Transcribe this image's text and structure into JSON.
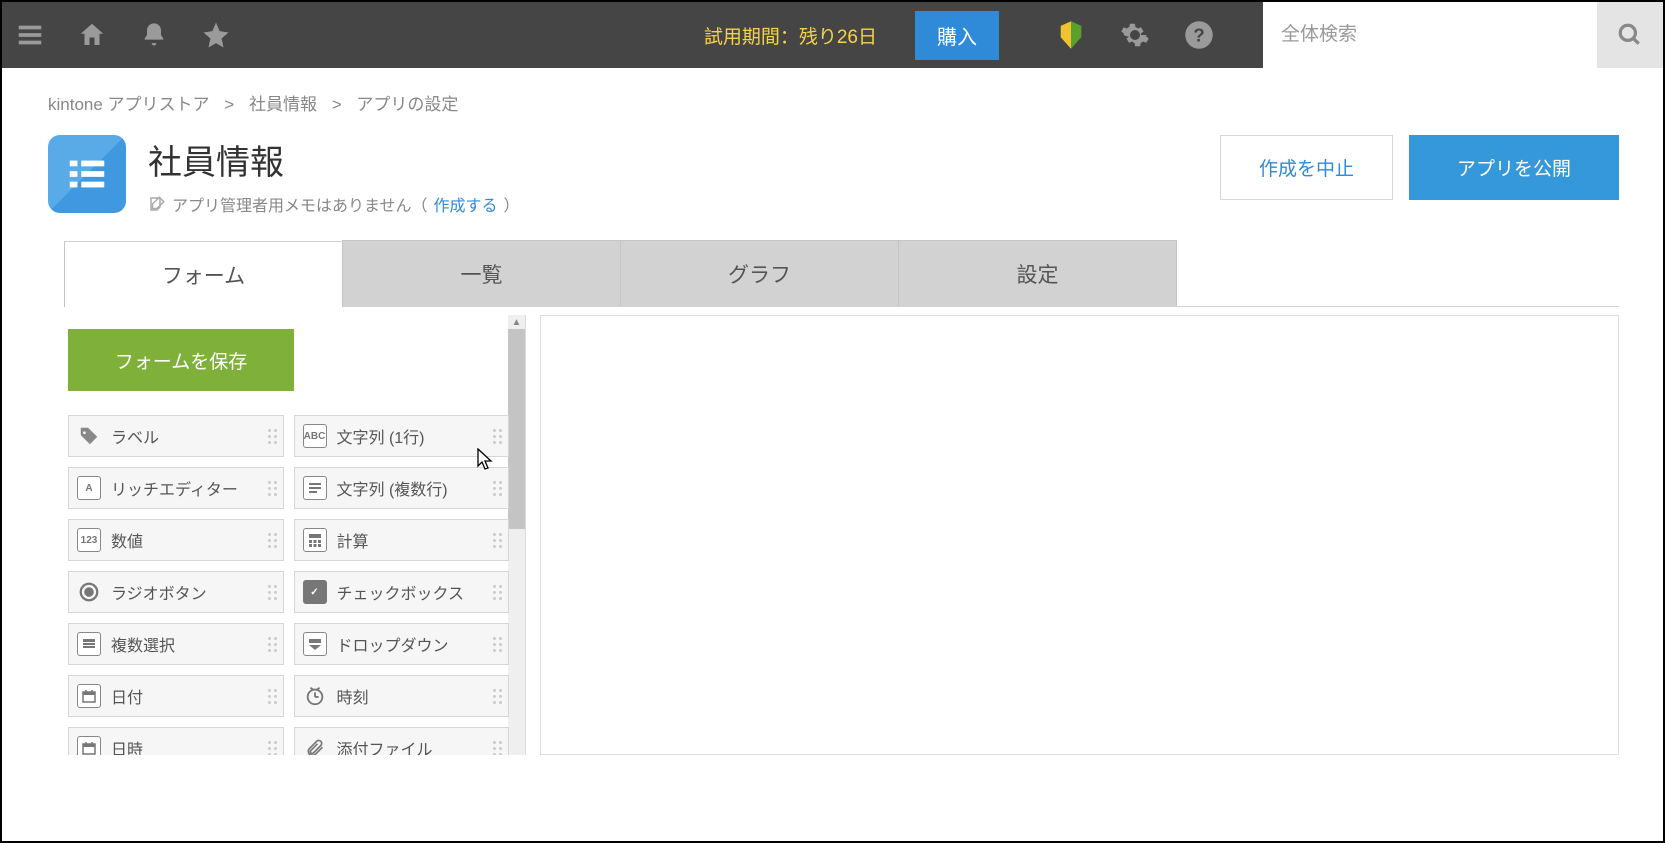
{
  "topbar": {
    "trial_text": "試用期間：残り26日",
    "buy_label": "購入",
    "search_placeholder": "全体検索"
  },
  "breadcrumb": {
    "items": [
      "kintone アプリストア",
      "社員情報",
      "アプリの設定"
    ]
  },
  "title": {
    "heading": "社員情報",
    "memo_text": "アプリ管理者用メモはありません（",
    "memo_link": "作成する",
    "memo_suffix": "）",
    "cancel_label": "作成を中止",
    "publish_label": "アプリを公開"
  },
  "tabs": {
    "items": [
      "フォーム",
      "一覧",
      "グラフ",
      "設定"
    ],
    "active_index": 0
  },
  "form_panel": {
    "save_label": "フォームを保存",
    "fields_left": [
      "ラベル",
      "リッチエディター",
      "数値",
      "ラジオボタン",
      "複数選択",
      "日付",
      "日時"
    ],
    "fields_right": [
      "文字列 (1行)",
      "文字列 (複数行)",
      "計算",
      "チェックボックス",
      "ドロップダウン",
      "時刻",
      "添付ファイル"
    ]
  }
}
